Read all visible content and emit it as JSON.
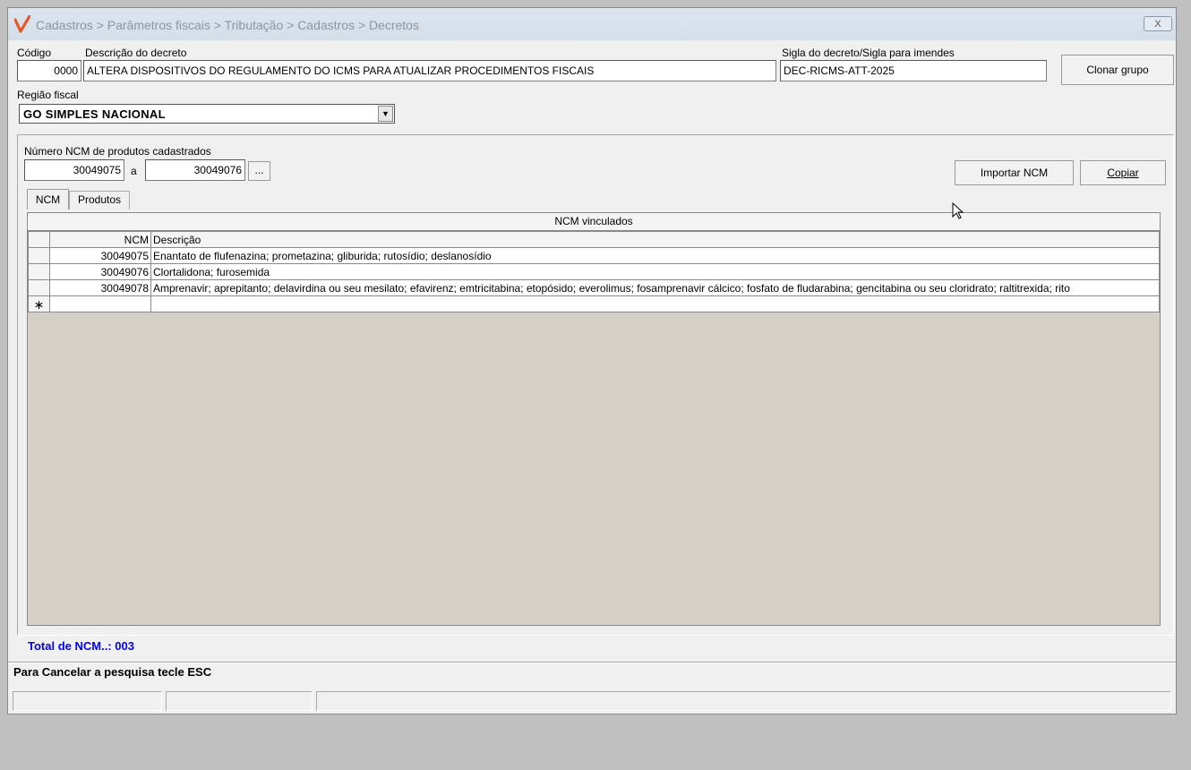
{
  "window": {
    "title": "Cadastros > Parâmetros fiscais > Tributação > Cadastros > Decretos",
    "close_label": "X"
  },
  "form": {
    "codigo_label": "Código",
    "codigo_value": "0000",
    "descricao_label": "Descrição do decreto",
    "descricao_value": "ALTERA DISPOSITIVOS DO REGULAMENTO DO ICMS PARA ATUALIZAR PROCEDIMENTOS FISCAIS",
    "sigla_label": "Sigla do decreto/Sigla para imendes",
    "sigla_value": "DEC-RICMS-ATT-2025",
    "clonar_label": "Clonar grupo",
    "regiao_label": "Região fiscal",
    "regiao_value": "GO SIMPLES NACIONAL"
  },
  "ncm_filter": {
    "label": "Número  NCM de produtos cadastrados",
    "from": "30049075",
    "separator": "a",
    "to": "30049076",
    "browse_label": "...",
    "importar_label": "Importar NCM",
    "copiar_label": "Copiar"
  },
  "tabs": [
    {
      "label": "NCM"
    },
    {
      "label": "Produtos"
    }
  ],
  "grid": {
    "caption": "NCM vinculados",
    "columns": [
      "NCM",
      "Descrição"
    ],
    "rows": [
      {
        "ncm": "30049075",
        "descricao": "Enantato de flufenazina; prometazina; gliburida; rutosídio; deslanosídio"
      },
      {
        "ncm": "30049076",
        "descricao": "Clortalidona; furosemida"
      },
      {
        "ncm": "30049078",
        "descricao": "Amprenavir; aprepitanto; delavirdina ou seu mesilato; efavirenz; emtricitabina; etopósido; everolimus; fosamprenavir cálcico; fosfato de fludarabina; gencitabina ou seu cloridrato; raltitrexida; rito"
      }
    ],
    "new_row_marker": "∗"
  },
  "footer": {
    "total": "Total de NCM..: 003",
    "status": "Para Cancelar a pesquisa tecle ESC"
  }
}
